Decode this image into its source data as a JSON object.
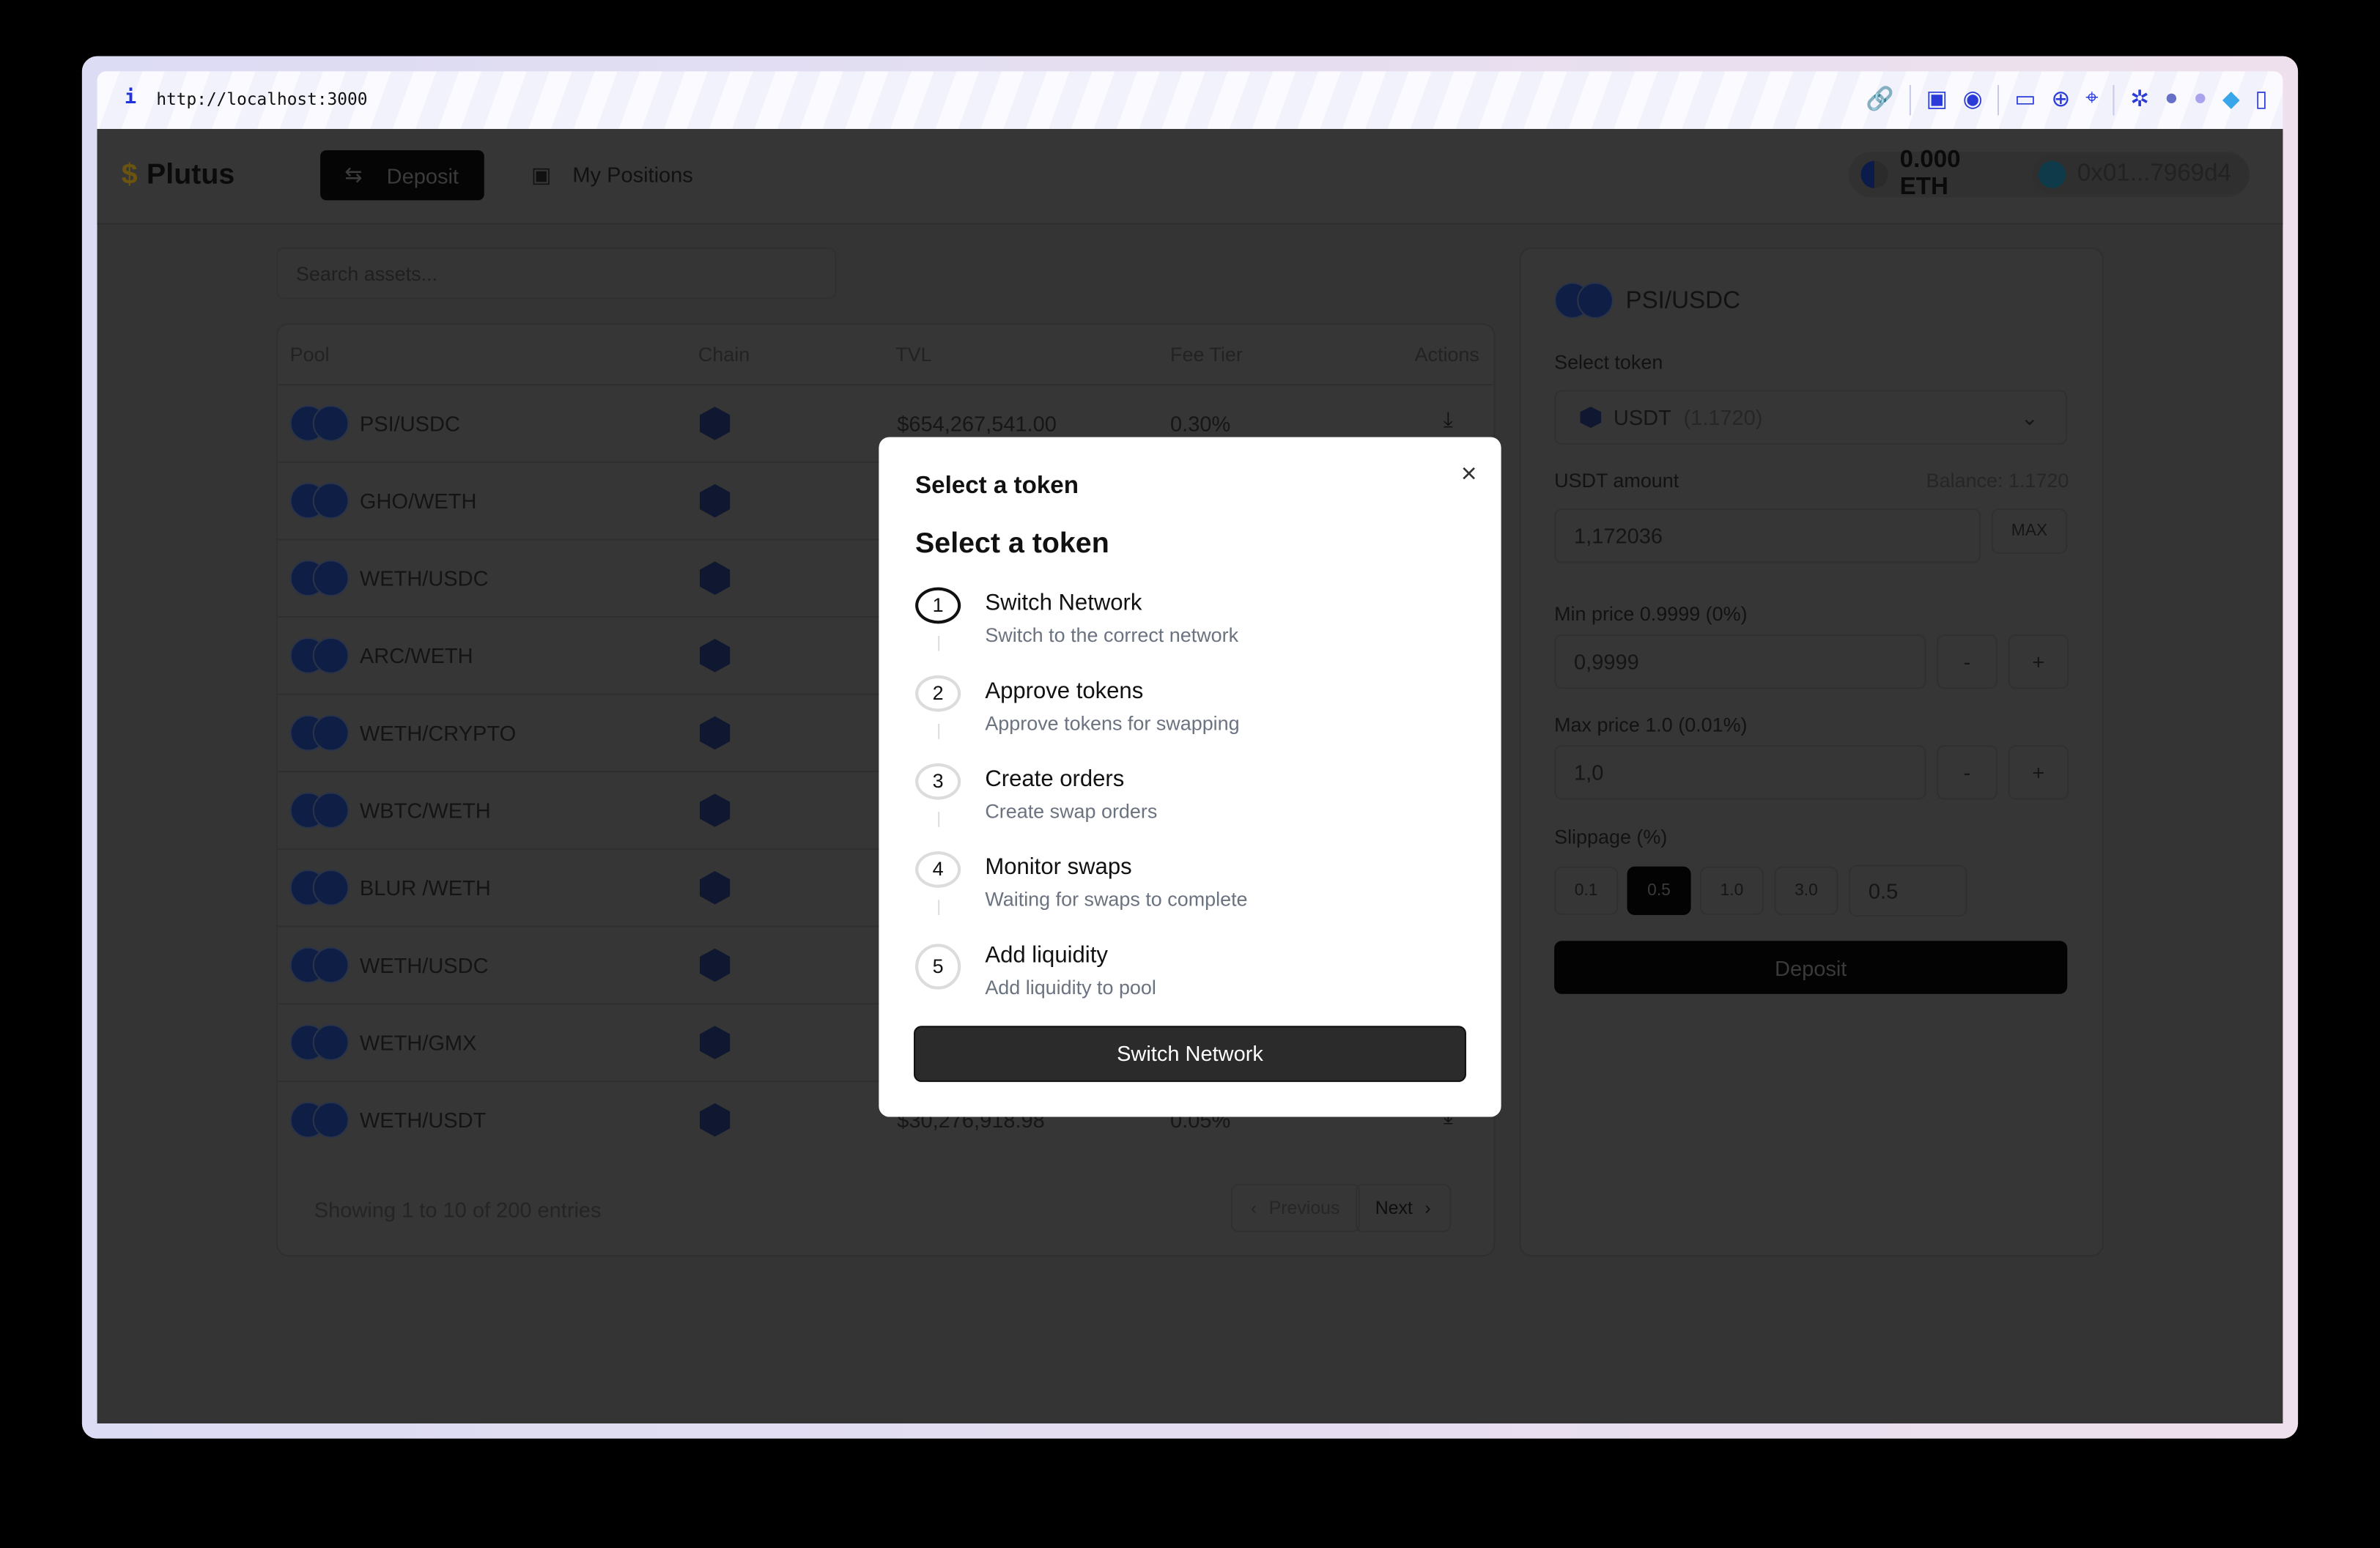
{
  "browser": {
    "url": "http://localhost:3000",
    "info_icon": "info-icon",
    "toolbar_icons": [
      "link-icon",
      "screenshot-icon",
      "camera-icon",
      "terminal-icon",
      "globe-icon",
      "crosshair-icon",
      "extension-icon",
      "extension-icon",
      "extension-icon",
      "gem-icon",
      "sidebar-icon"
    ]
  },
  "header": {
    "brand": "Plutus",
    "deposit_label": "Deposit",
    "positions_label": "My Positions",
    "balance": "0.000 ETH",
    "account": "0x01...7969d4"
  },
  "search": {
    "placeholder": "Search assets..."
  },
  "table": {
    "columns": [
      "Pool",
      "Chain",
      "TVL",
      "Fee Tier",
      "Actions"
    ],
    "rows": [
      {
        "pool": "PSI/USDC",
        "tvl": "$654,267,541.00",
        "fee": "0.30%"
      },
      {
        "pool": "GHO/WETH"
      },
      {
        "pool": "WETH/USDC"
      },
      {
        "pool": "ARC/WETH"
      },
      {
        "pool": "WETH/CRYPTO"
      },
      {
        "pool": "WBTC/WETH"
      },
      {
        "pool": "BLUR /WETH"
      },
      {
        "pool": "WETH/USDC"
      },
      {
        "pool": "WETH/GMX"
      },
      {
        "pool": "WETH/USDT",
        "tvl": "$30,276,918.98",
        "fee": "0.05%"
      }
    ],
    "footer": "Showing 1 to 10 of 200 entries",
    "previous": "Previous",
    "next": "Next"
  },
  "side": {
    "pair": "PSI/USDC",
    "select_token_label": "Select token",
    "token": "USDT",
    "token_balance": "(1.1720)",
    "amount_label": "USDT amount",
    "balance": "Balance: 1.1720",
    "amount": "1,172036",
    "max": "MAX",
    "min_label": "Min price 0.9999 (0%)",
    "min_value": "0,9999",
    "max_label": "Max price 1.0 (0.01%)",
    "max_value": "1,0",
    "minus": "-",
    "plus": "+",
    "slippage_label": "Slippage (%)",
    "slippage_options": [
      "0.1",
      "0.5",
      "1.0",
      "3.0"
    ],
    "slippage_selected": "0.5",
    "slippage_custom": "0.5",
    "deposit": "Deposit"
  },
  "modal": {
    "title": "Select a token",
    "subtitle": "Select a token",
    "close": "×",
    "steps": [
      {
        "n": "1",
        "title": "Switch Network",
        "desc": "Switch to the correct network"
      },
      {
        "n": "2",
        "title": "Approve tokens",
        "desc": "Approve tokens for swapping"
      },
      {
        "n": "3",
        "title": "Create orders",
        "desc": "Create swap orders"
      },
      {
        "n": "4",
        "title": "Monitor swaps",
        "desc": "Waiting for swaps to complete"
      },
      {
        "n": "5",
        "title": "Add liquidity",
        "desc": "Add liquidity to pool"
      }
    ],
    "button": "Switch Network"
  }
}
